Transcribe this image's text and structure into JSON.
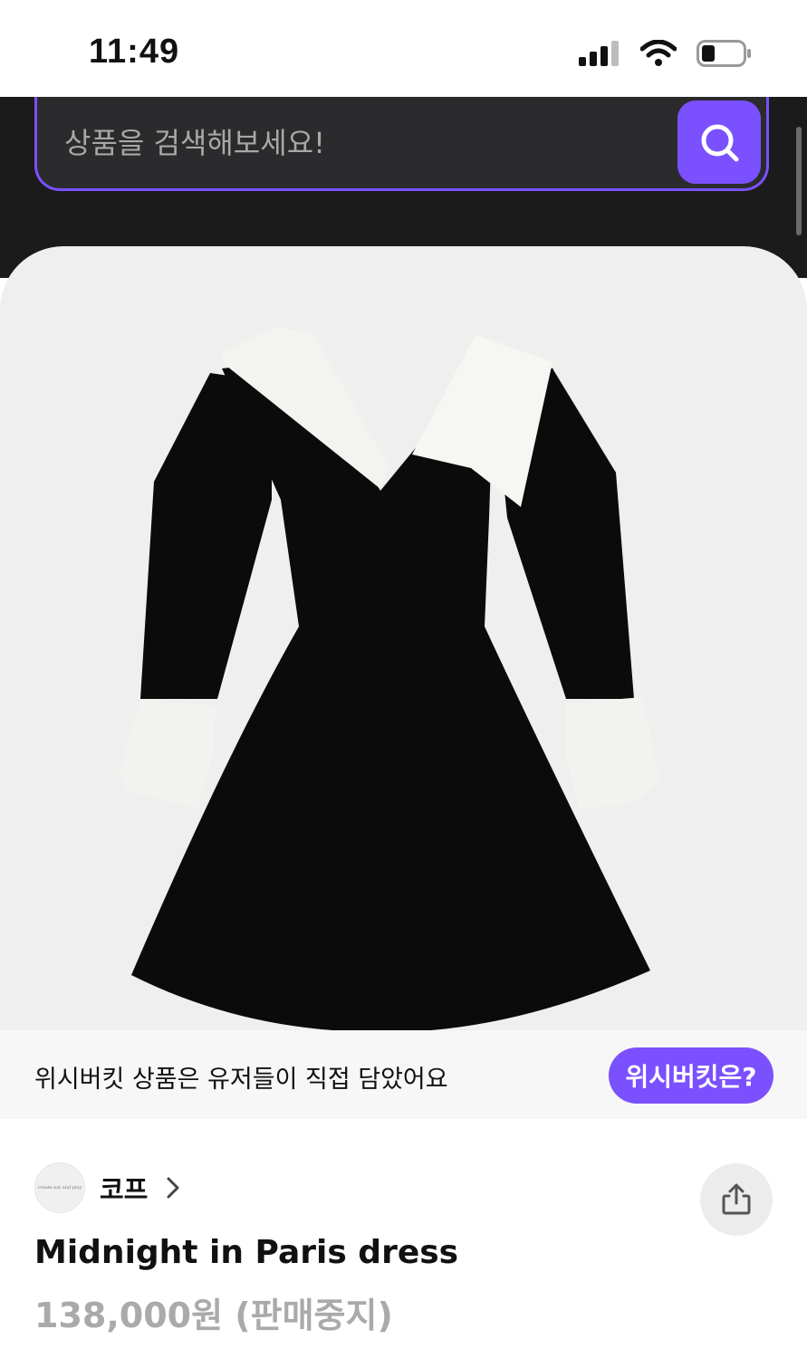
{
  "status_bar": {
    "time": "11:49",
    "icons": [
      "signal-icon",
      "wifi-icon",
      "battery-icon"
    ]
  },
  "search": {
    "placeholder": "상품을 검색해보세요!",
    "button_icon": "search-icon"
  },
  "product_image": {
    "subject": "dress"
  },
  "info_banner": {
    "text": "위시버킷 상품은 유저들이 직접 담았어요",
    "button_label": "위시버킷은?"
  },
  "shop": {
    "name": "코프",
    "avatar_text": "create eat and play"
  },
  "product": {
    "title": "Midnight in Paris dress",
    "price": "138,000원 (판매중지)"
  },
  "colors": {
    "accent": "#7b50ff",
    "header_bg": "#1b1b1b",
    "search_bg": "#2b2b2d",
    "price_gray": "#aaaaaa"
  }
}
